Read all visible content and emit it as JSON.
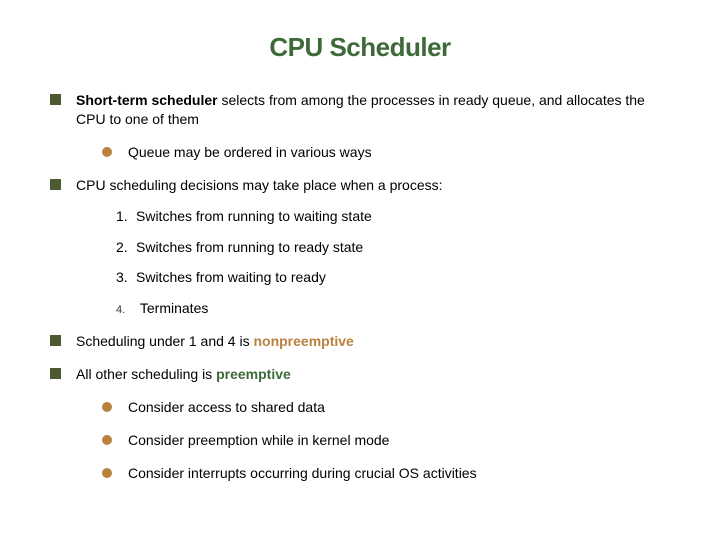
{
  "title": "CPU Scheduler",
  "items": [
    {
      "boldLead": "Short-term scheduler",
      "rest": " selects from among the processes in ready queue, and allocates the CPU to one of them",
      "sub": [
        {
          "text": "Queue may be ordered in various ways"
        }
      ]
    },
    {
      "text": "CPU scheduling decisions may take place when a process:",
      "numbered": [
        "Switches from running to waiting state",
        "Switches from running to ready state",
        "Switches from waiting to ready",
        "Terminates"
      ]
    },
    {
      "prefix": "Scheduling under 1 and 4 is ",
      "highlight": "nonpreemptive",
      "hlClass": "hl"
    },
    {
      "prefix": "All other scheduling is ",
      "highlight": "preemptive",
      "hlClass": "hl-green",
      "sub": [
        {
          "text": "Consider access to shared data"
        },
        {
          "text": "Consider preemption while in kernel mode"
        },
        {
          "text": "Consider interrupts occurring during crucial OS activities"
        }
      ]
    }
  ]
}
